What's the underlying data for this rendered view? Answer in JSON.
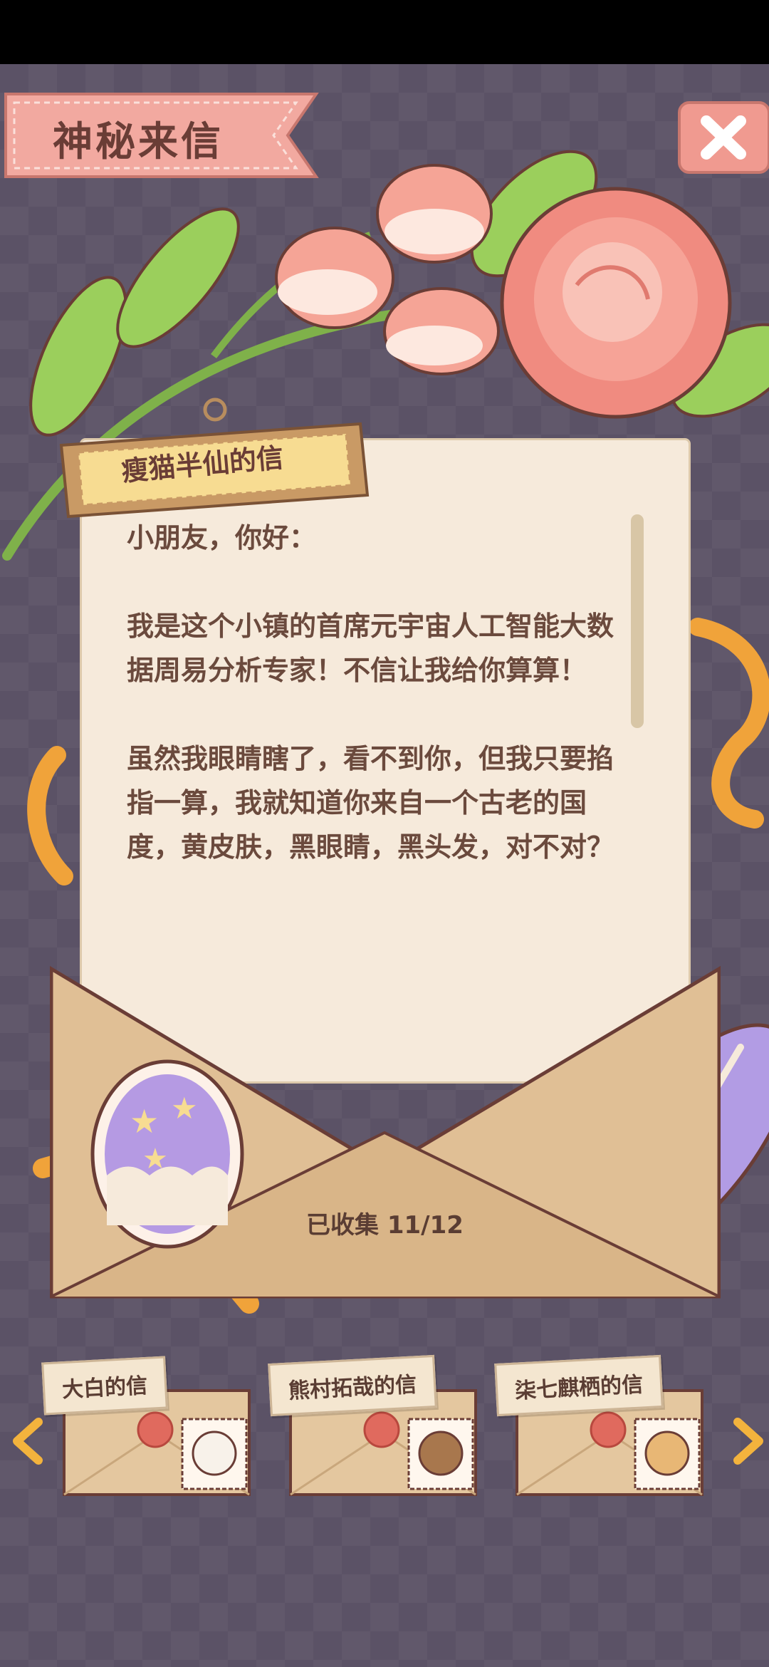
{
  "page": {
    "title": "神秘来信"
  },
  "letter": {
    "sender": "瘦猫半仙的信",
    "body": "小朋友，你好：\n\n我是这个小镇的首席元宇宙人工智能大数据周易分析专家！不信让我给你算算！\n\n虽然我眼睛瞎了，看不到你，但我只要掐指一算，我就知道你来自一个古老的国度，黄皮肤，黑眼睛，黑头发，对不对？"
  },
  "collection": {
    "label": "已收集 11/12",
    "collected": 11,
    "total": 12
  },
  "cards": [
    {
      "label": "大白的信"
    },
    {
      "label": "熊村拓哉的信"
    },
    {
      "label": "柒七麒栖的信"
    }
  ],
  "icons": {
    "close": "close-icon",
    "prev": "chevron-left-icon",
    "next": "chevron-right-icon"
  },
  "colors": {
    "background": "#5b5266",
    "banner": "#f2a9a0",
    "paper": "#f6eadb",
    "envelope": "#e0bf95",
    "text": "#6b4a3d",
    "arrow": "#f3b33d"
  }
}
